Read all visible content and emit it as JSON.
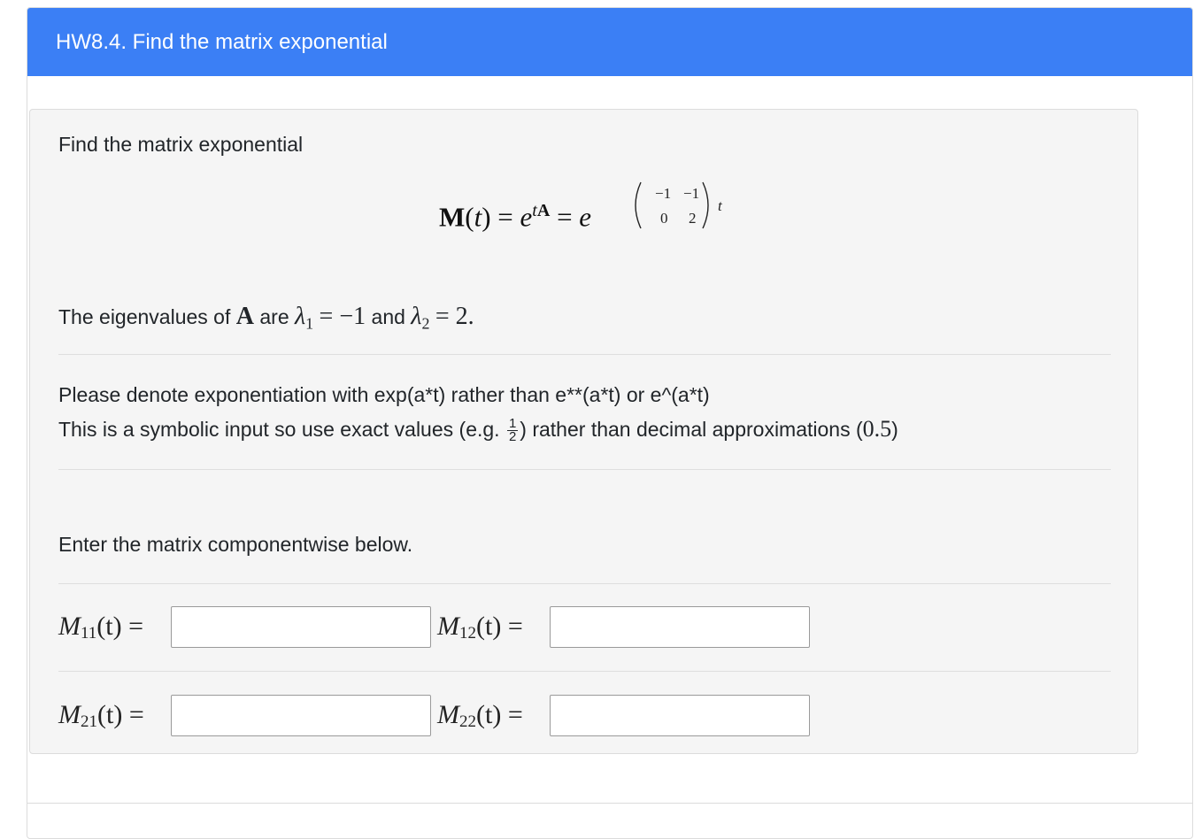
{
  "header": {
    "title": "HW8.4. Find the matrix exponential"
  },
  "question": {
    "intro": "Find the matrix exponential",
    "display_eq": {
      "lhs": "M",
      "t": "t",
      "eq": "=",
      "e": "e",
      "sup_t": "t",
      "sup_A": "A",
      "matrix": [
        "−1",
        "−1",
        "0",
        "2"
      ]
    },
    "eigen": {
      "prefix": "The eigenvalues of",
      "A": "A",
      "are": "are",
      "lambda1": "λ",
      "sub1": "1",
      "val1": "= −1",
      "and": "and",
      "lambda2": "λ",
      "sub2": "2",
      "val2": "= 2."
    },
    "instruction_1": "Please denote exponentiation with exp(a*t) rather than e**(a*t) or e^(a*t)",
    "instruction_2_a": "This is a symbolic input so use exact values (e.g.",
    "instruction_2_num": "1",
    "instruction_2_den": "2",
    "instruction_2_b": ") rather than decimal approximations (",
    "instruction_2_dec": "0.5",
    "instruction_2_c": ")",
    "enter_text": "Enter the matrix componentwise below.",
    "fields": [
      {
        "M": "M",
        "sub": "11",
        "tail": "(t) =",
        "value": ""
      },
      {
        "M": "M",
        "sub": "12",
        "tail": "(t) =",
        "value": ""
      },
      {
        "M": "M",
        "sub": "21",
        "tail": "(t) =",
        "value": ""
      },
      {
        "M": "M",
        "sub": "22",
        "tail": "(t) =",
        "value": ""
      }
    ]
  }
}
